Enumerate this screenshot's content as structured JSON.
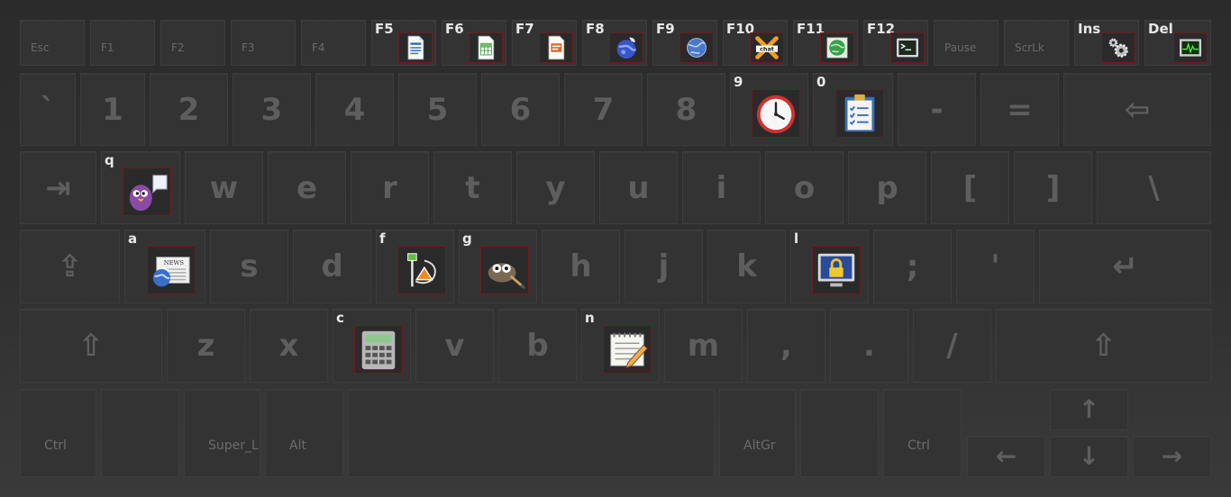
{
  "keyboard": {
    "rows": [
      {
        "kind": "fn",
        "keys": [
          {
            "label": "Esc"
          },
          {
            "label": "F1"
          },
          {
            "label": "F2"
          },
          {
            "label": "F3"
          },
          {
            "label": "F4"
          },
          {
            "label": "",
            "hint": "F5",
            "icon": "writer-document-icon"
          },
          {
            "label": "",
            "hint": "F6",
            "icon": "spreadsheet-icon"
          },
          {
            "label": "",
            "hint": "F7",
            "icon": "presentation-icon"
          },
          {
            "label": "",
            "hint": "F8",
            "icon": "web-browser-icon"
          },
          {
            "label": "",
            "hint": "F9",
            "icon": "network-globe-icon"
          },
          {
            "label": "",
            "hint": "F10",
            "icon": "xchat-icon"
          },
          {
            "label": "",
            "hint": "F11",
            "icon": "green-globe-icon"
          },
          {
            "label": "",
            "hint": "F12",
            "icon": "terminal-icon"
          },
          {
            "label": "Pause"
          },
          {
            "label": "ScrLk"
          },
          {
            "label": "",
            "hint": "Ins",
            "icon": "settings-gears-icon"
          },
          {
            "label": "",
            "hint": "Del",
            "icon": "system-monitor-icon"
          }
        ]
      },
      {
        "kind": "main",
        "keys": [
          {
            "label": "`"
          },
          {
            "label": "1"
          },
          {
            "label": "2"
          },
          {
            "label": "3"
          },
          {
            "label": "4"
          },
          {
            "label": "5"
          },
          {
            "label": "6"
          },
          {
            "label": "7"
          },
          {
            "label": "8"
          },
          {
            "label": "",
            "hint": "9",
            "icon": "clock-icon"
          },
          {
            "label": "",
            "hint": "0",
            "icon": "clipboard-icon"
          },
          {
            "label": "-"
          },
          {
            "label": "="
          },
          {
            "label": "⇦"
          }
        ]
      },
      {
        "kind": "main",
        "keys": [
          {
            "label": "⇥"
          },
          {
            "label": "",
            "hint": "q",
            "icon": "pidgin-chat-icon"
          },
          {
            "label": "w"
          },
          {
            "label": "e"
          },
          {
            "label": "r"
          },
          {
            "label": "t"
          },
          {
            "label": "y"
          },
          {
            "label": "u"
          },
          {
            "label": "i"
          },
          {
            "label": "o"
          },
          {
            "label": "p"
          },
          {
            "label": "["
          },
          {
            "label": "]"
          },
          {
            "label": "\\"
          }
        ]
      },
      {
        "kind": "main",
        "keys": [
          {
            "label": "⇪"
          },
          {
            "label": "",
            "hint": "a",
            "icon": "news-reader-icon"
          },
          {
            "label": "s"
          },
          {
            "label": "d"
          },
          {
            "label": "",
            "hint": "f",
            "icon": "vector-draw-icon"
          },
          {
            "label": "",
            "hint": "g",
            "icon": "gimp-icon"
          },
          {
            "label": "h"
          },
          {
            "label": "j"
          },
          {
            "label": "k"
          },
          {
            "label": "",
            "hint": "l",
            "icon": "lock-screen-icon"
          },
          {
            "label": ";"
          },
          {
            "label": "'"
          },
          {
            "label": "↵"
          }
        ]
      },
      {
        "kind": "main",
        "keys": [
          {
            "label": "⇧"
          },
          {
            "label": "z"
          },
          {
            "label": "x"
          },
          {
            "label": "",
            "hint": "c",
            "icon": "calculator-icon"
          },
          {
            "label": "v"
          },
          {
            "label": "b"
          },
          {
            "label": "",
            "hint": "n",
            "icon": "text-editor-icon"
          },
          {
            "label": "m"
          },
          {
            "label": ","
          },
          {
            "label": "."
          },
          {
            "label": "/"
          },
          {
            "label": "⇧"
          }
        ]
      },
      {
        "kind": "mod",
        "keys": [
          {
            "label": "Ctrl"
          },
          {
            "label": ""
          },
          {
            "label": "Super_L"
          },
          {
            "label": "Alt"
          },
          {
            "label": ""
          },
          {
            "label": "AltGr"
          },
          {
            "label": ""
          },
          {
            "label": "Ctrl"
          }
        ]
      }
    ],
    "arrows": {
      "up": "↑",
      "left": "←",
      "down": "↓",
      "right": "→"
    }
  }
}
